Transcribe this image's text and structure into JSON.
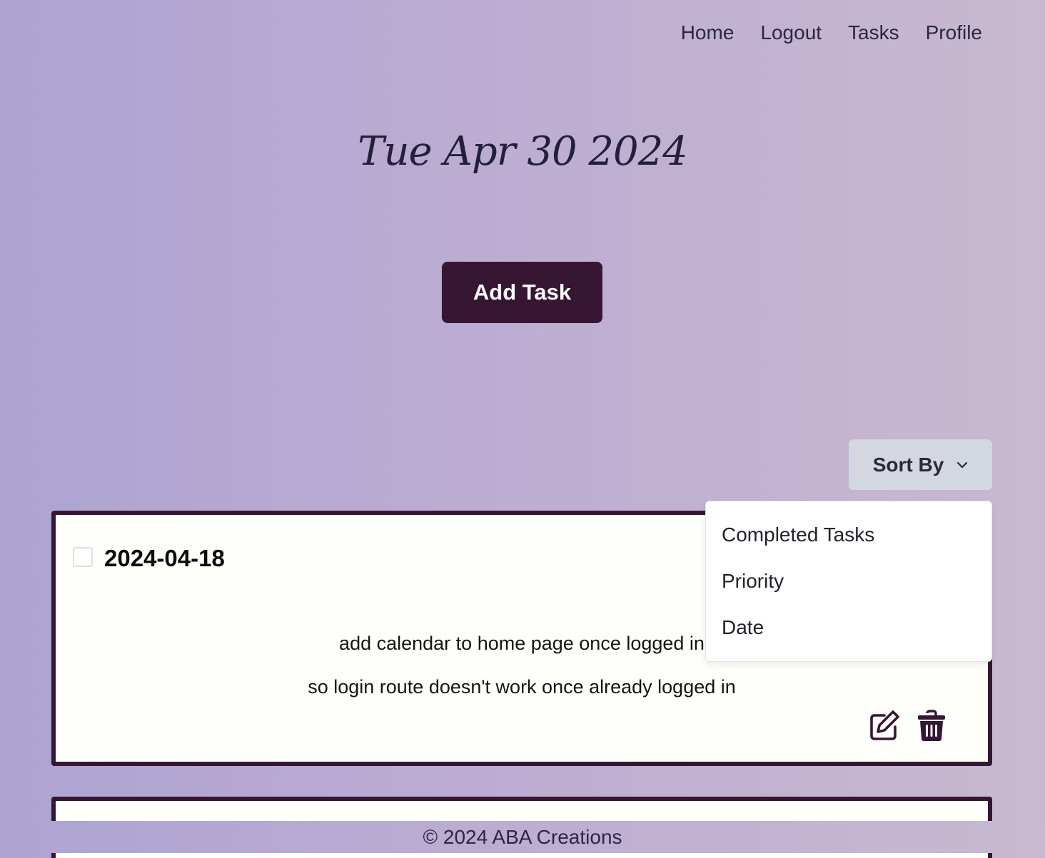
{
  "nav": {
    "items": [
      {
        "label": "Home"
      },
      {
        "label": "Logout"
      },
      {
        "label": "Tasks"
      },
      {
        "label": "Profile"
      }
    ]
  },
  "header": {
    "date": "Tue Apr 30 2024"
  },
  "actions": {
    "add_task_label": "Add Task"
  },
  "sort": {
    "label": "Sort By",
    "options": [
      "Completed Tasks",
      "Priority",
      "Date"
    ]
  },
  "tasks": [
    {
      "date": "2024-04-18",
      "completed": false,
      "description_lines": [
        "add calendar to home page once logged in",
        "so login route doesn't work once already logged in"
      ]
    }
  ],
  "footer": {
    "text": "© 2024 ABA Creations"
  },
  "colors": {
    "primary": "#371634",
    "sort_button_bg": "#d3d7e0",
    "card_bg": "#fefefa"
  }
}
